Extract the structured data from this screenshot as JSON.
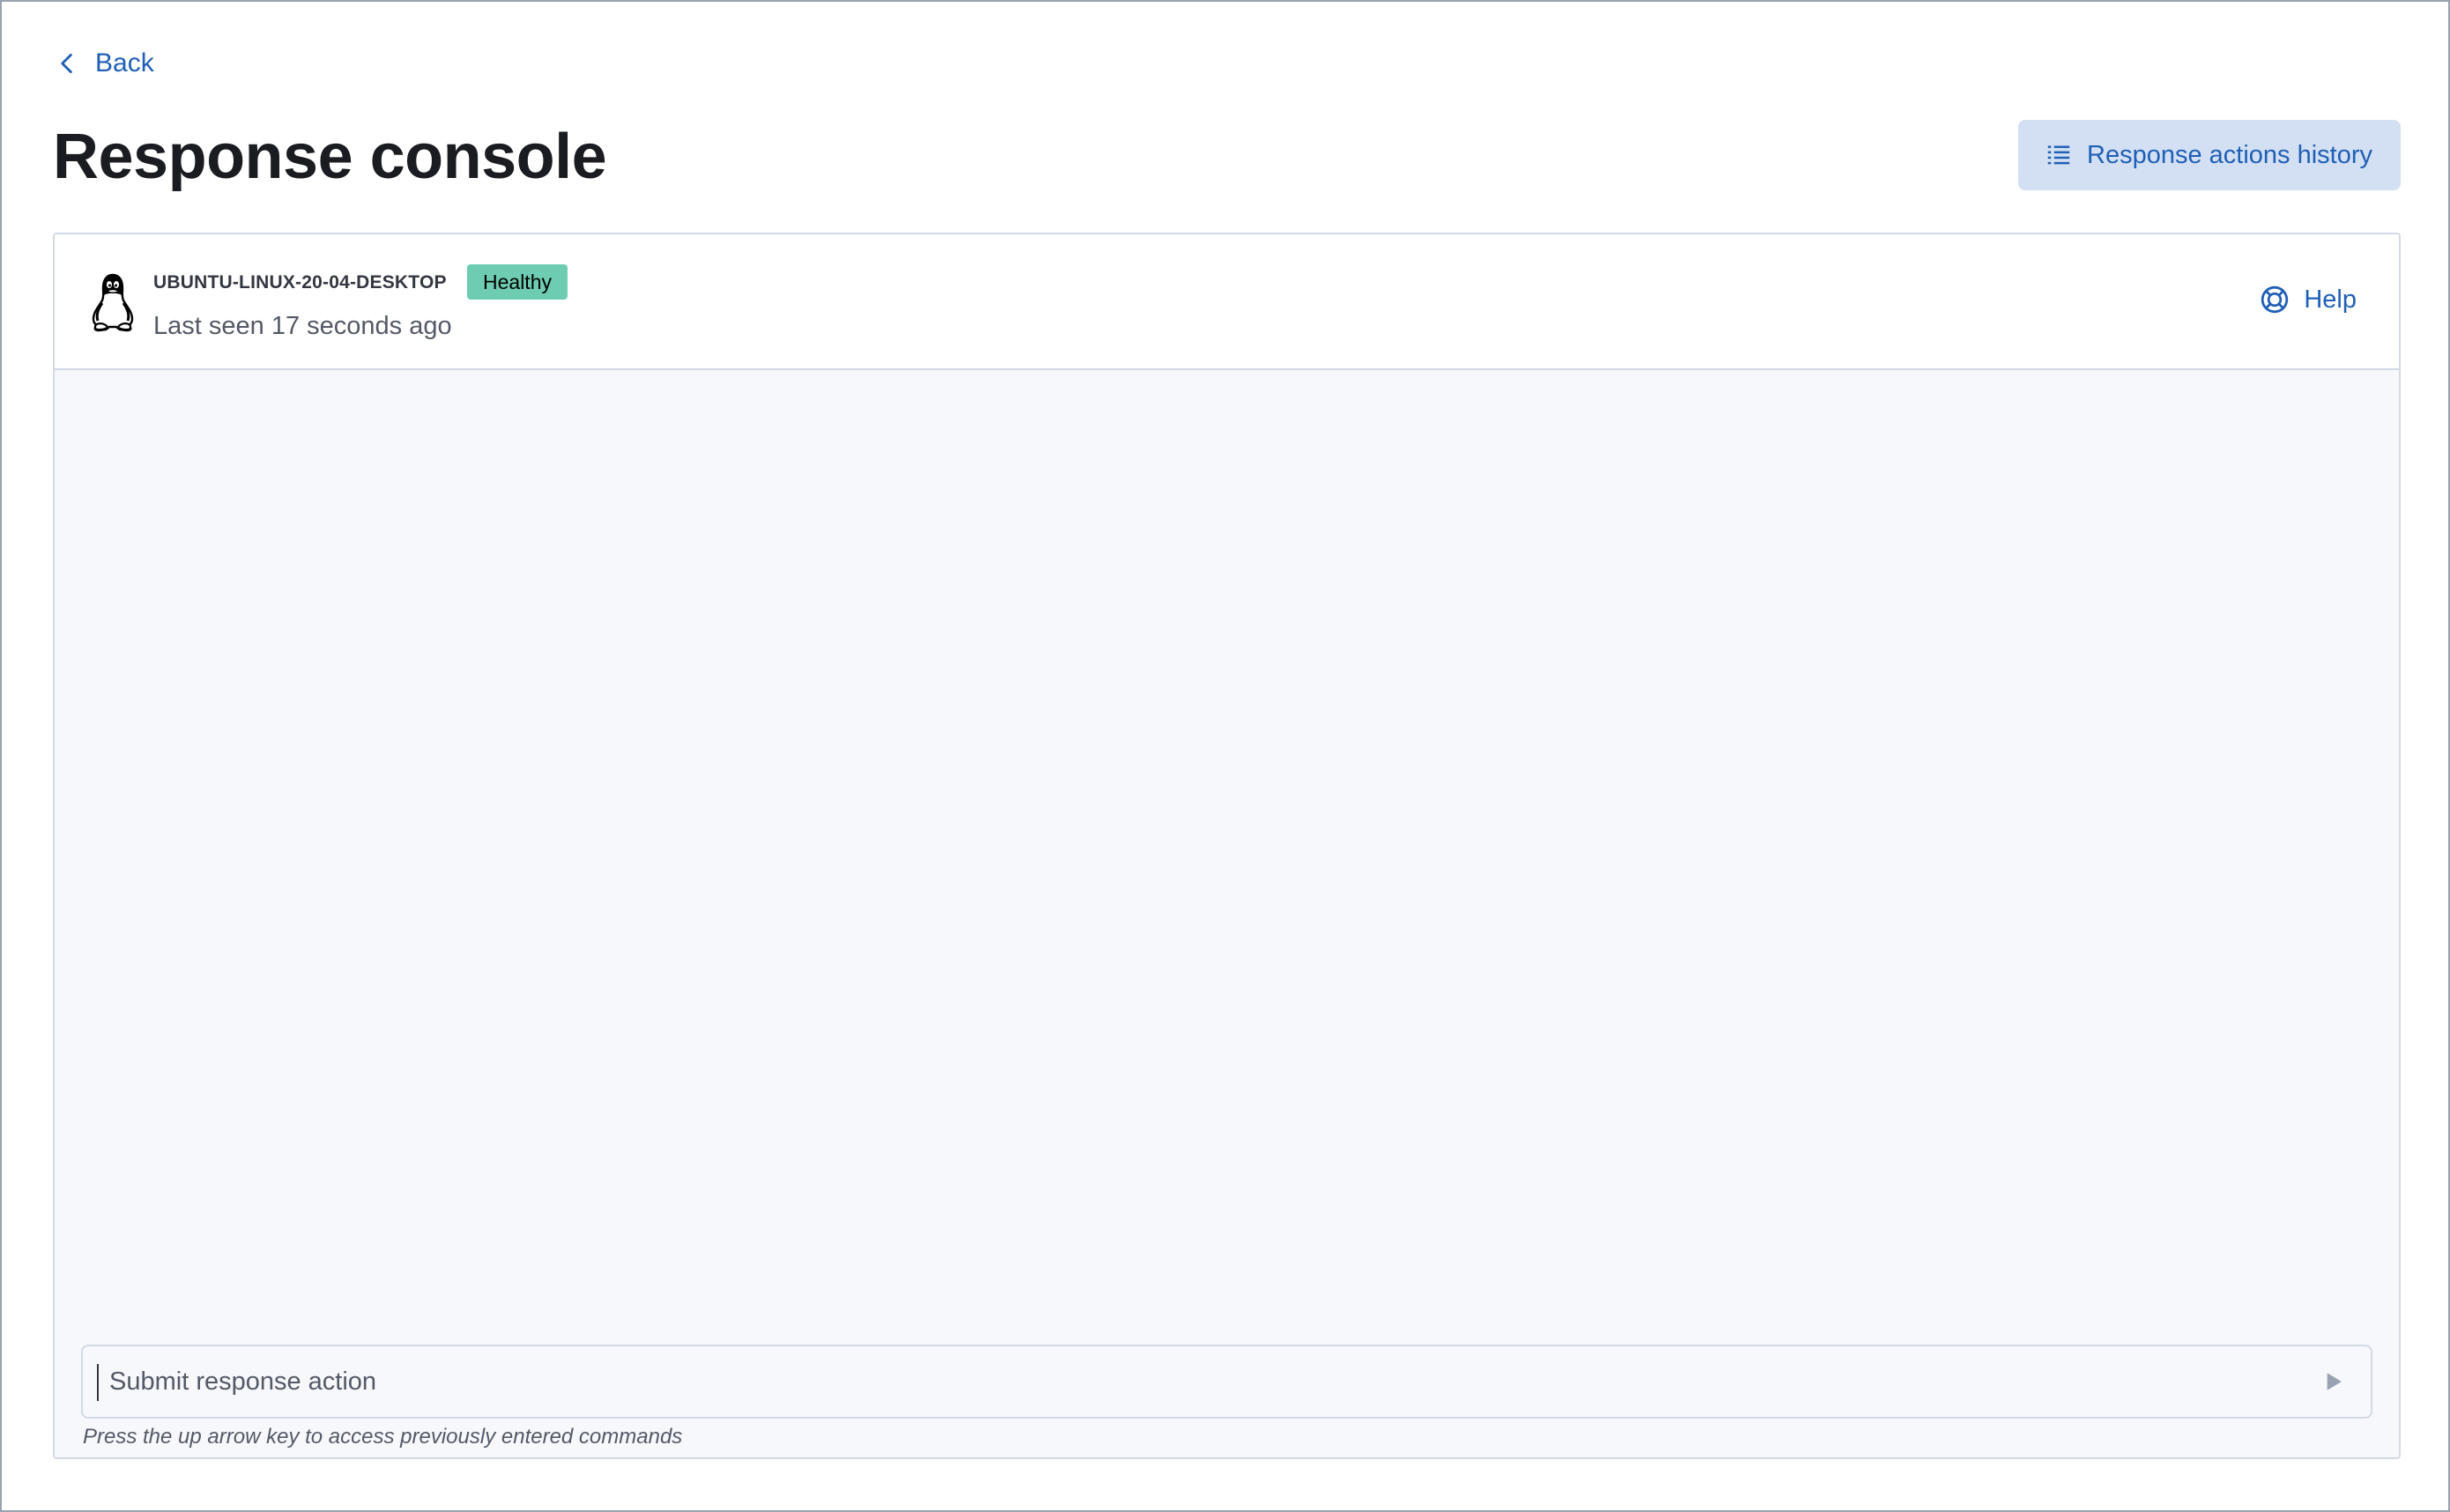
{
  "nav": {
    "back_label": "Back"
  },
  "header": {
    "title": "Response console",
    "history_button_label": "Response actions history"
  },
  "endpoint": {
    "host_name": "UBUNTU-LINUX-20-04-DESKTOP",
    "health_status": "Healthy",
    "last_seen": "Last seen 17 seconds ago",
    "os_icon": "linux-penguin-icon"
  },
  "help": {
    "label": "Help"
  },
  "console": {
    "input_placeholder": "Submit response action",
    "input_value": "",
    "hint": "Press the up arrow key to access previously entered commands"
  },
  "colors": {
    "link": "#1f5fb5",
    "history_button_bg": "#d3e0f3",
    "healthy_badge": "#6dccb1",
    "console_bg": "#f7f8fc",
    "border": "#d3dae6"
  }
}
